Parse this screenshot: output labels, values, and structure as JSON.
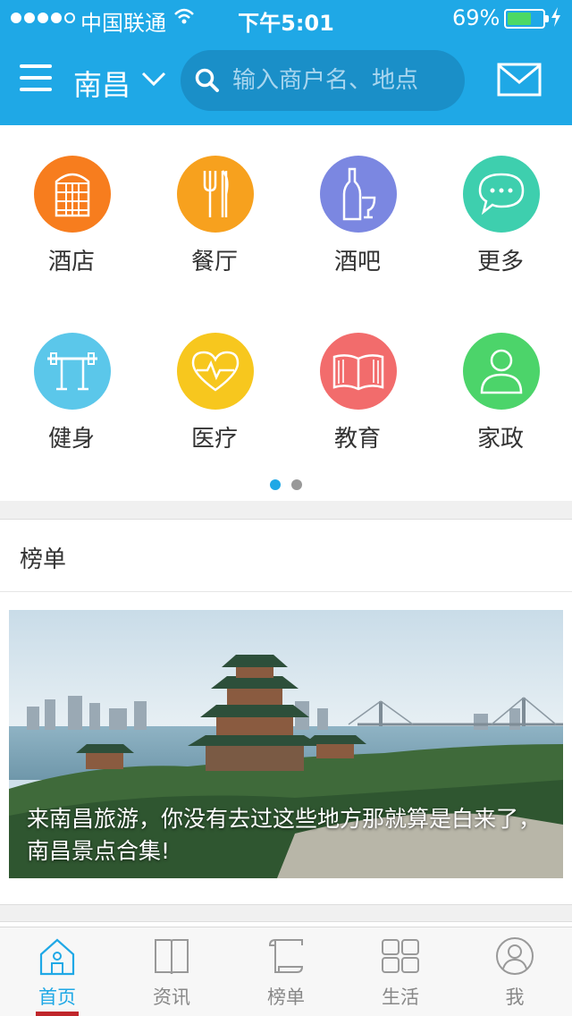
{
  "status_bar": {
    "carrier": "中国联通",
    "time": "下午5:01",
    "battery_percent": "69%",
    "battery_level": 0.69,
    "signal_bars_filled": 4
  },
  "header": {
    "city": "南昌",
    "search_placeholder": "输入商户名、地点",
    "icons": {
      "menu": "menu-icon",
      "chevron": "chevron-down-icon",
      "search": "search-icon",
      "mail": "mail-icon"
    }
  },
  "categories": [
    {
      "label": "酒店",
      "icon": "hotel-icon",
      "color": "#f77d1e"
    },
    {
      "label": "餐厅",
      "icon": "fork-knife-icon",
      "color": "#f7a11e"
    },
    {
      "label": "酒吧",
      "icon": "wine-bottle-icon",
      "color": "#7b87e1"
    },
    {
      "label": "更多",
      "icon": "chat-bubble-icon",
      "color": "#3ecfae"
    },
    {
      "label": "健身",
      "icon": "barbell-icon",
      "color": "#5bc7ea"
    },
    {
      "label": "医疗",
      "icon": "heart-pulse-icon",
      "color": "#f7c71e"
    },
    {
      "label": "教育",
      "icon": "open-book-icon",
      "color": "#f26c6c"
    },
    {
      "label": "家政",
      "icon": "person-icon",
      "color": "#4cd46a"
    }
  ],
  "pager": {
    "pages": 2,
    "current": 1
  },
  "ranking": {
    "title": "榜单",
    "card_caption": "来南昌旅游，你没有去过这些地方那就算是白来了，南昌景点合集!"
  },
  "tabbar": {
    "tabs": [
      {
        "label": "首页",
        "icon": "home-icon",
        "active": true
      },
      {
        "label": "资讯",
        "icon": "book-icon",
        "active": false
      },
      {
        "label": "榜单",
        "icon": "scroll-icon",
        "active": false
      },
      {
        "label": "生活",
        "icon": "grid-icon",
        "active": false
      },
      {
        "label": "我",
        "icon": "user-icon",
        "active": false
      }
    ]
  },
  "colors": {
    "primary": "#1fa8e6",
    "search_bg": "#1a8fc8",
    "active_underline": "#c0262b"
  }
}
